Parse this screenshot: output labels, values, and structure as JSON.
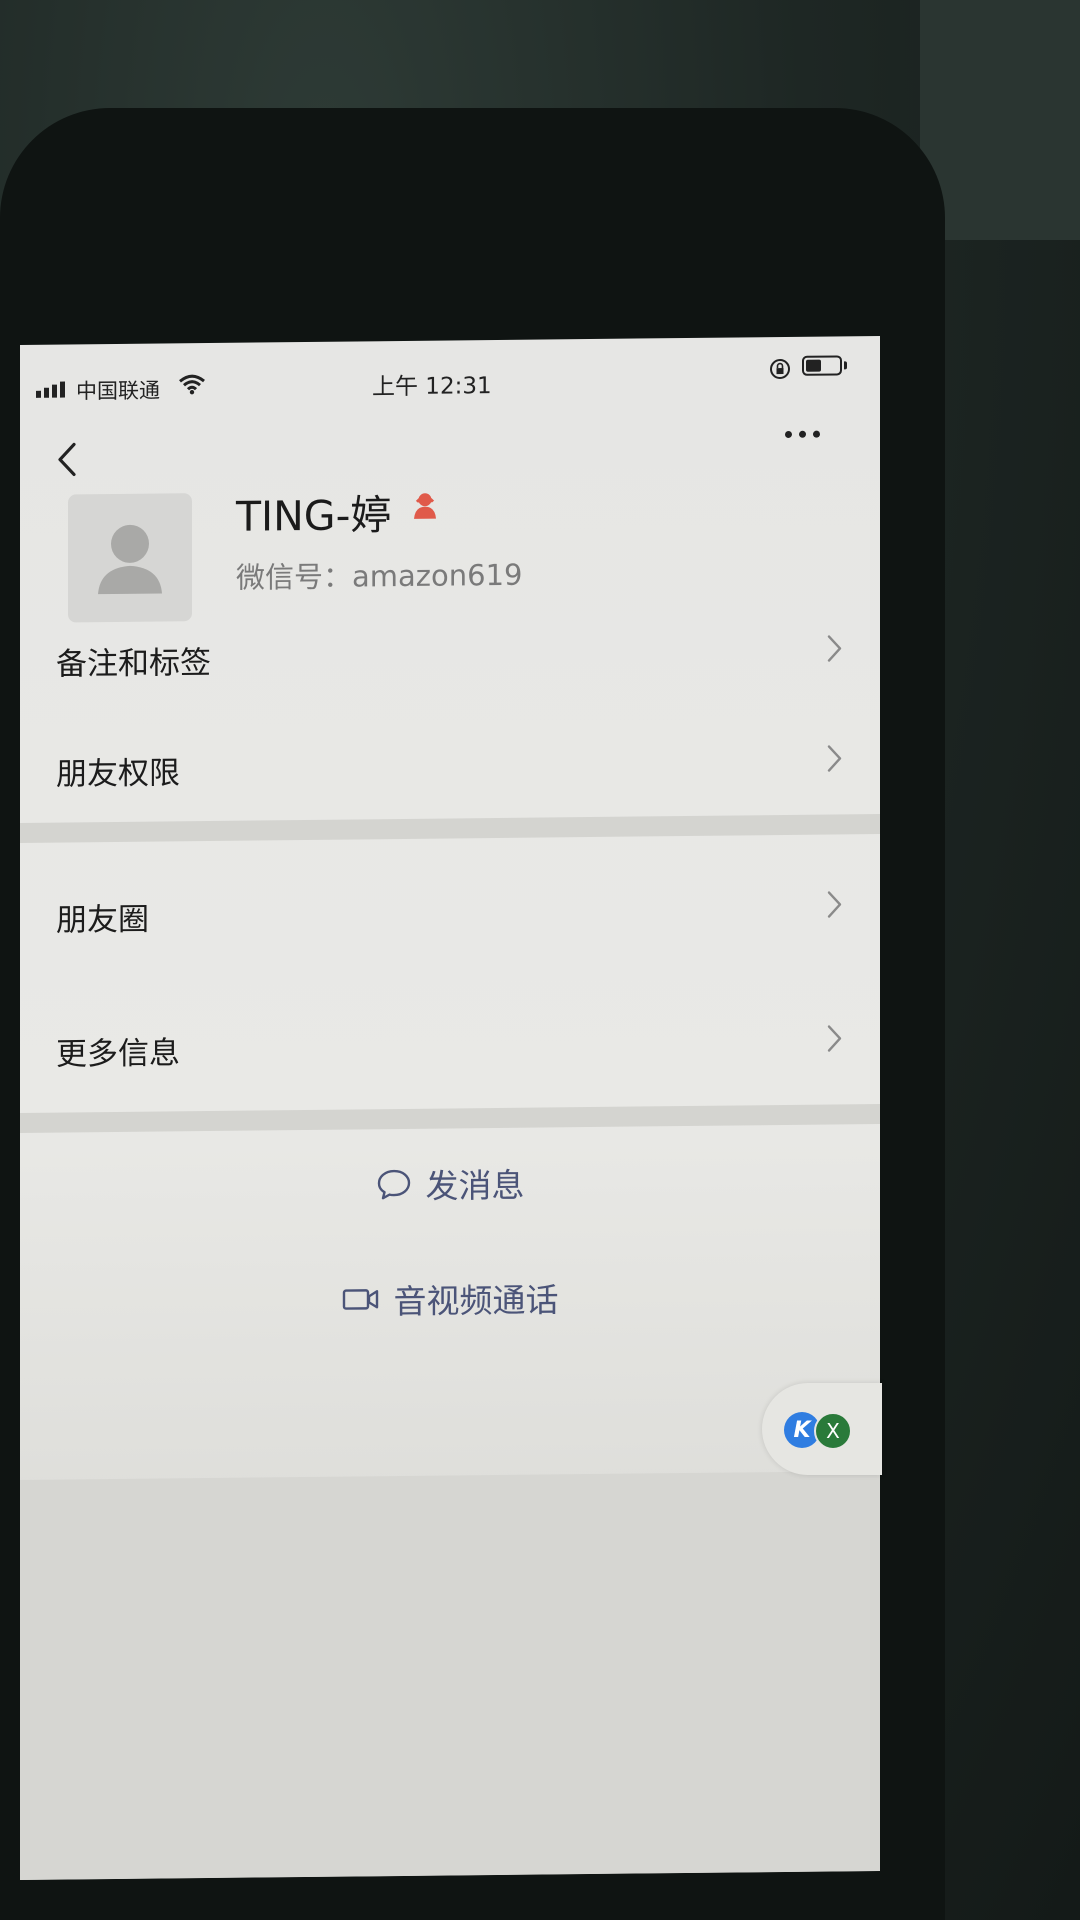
{
  "status_bar": {
    "carrier": "中国联通",
    "time": "上午 12:31"
  },
  "nav": {
    "back_icon": "chevron-left-icon",
    "more_icon": "more-dots-icon"
  },
  "profile": {
    "name": "TING-婷",
    "wechat_id": "微信号：amazon619",
    "gender_icon": "female-icon",
    "gender_color": "#e05a4a"
  },
  "menu_group_1": [
    {
      "label": "备注和标签"
    },
    {
      "label": "朋友权限"
    }
  ],
  "menu_group_2": [
    {
      "label": "朋友圈"
    },
    {
      "label": "更多信息"
    }
  ],
  "actions": {
    "send_message": "发消息",
    "video_call": "音视频通话"
  },
  "floating": {
    "badge_k": "K",
    "close": "X"
  },
  "colors": {
    "action_text": "#4b5478",
    "background": "#e8e8e5",
    "separator": "#d4d4d0"
  }
}
